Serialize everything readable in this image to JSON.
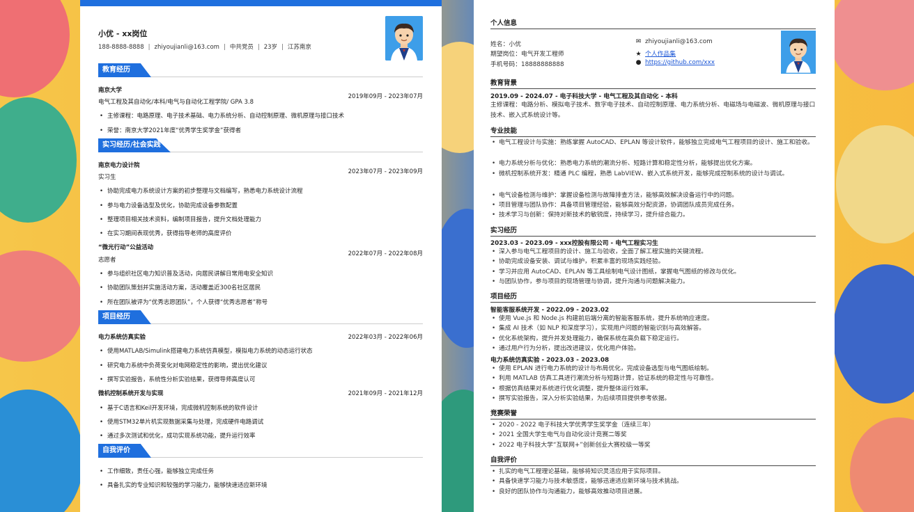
{
  "left": {
    "name": "小优 - xx岗位",
    "contact": [
      "188-8888-8888",
      "zhiyoujianli@163.com",
      "中共党员",
      "23岁",
      "江苏南京"
    ],
    "sections": {
      "education": "教育经历",
      "internship": "实习经历/社会实践",
      "project": "项目经历",
      "self_eval": "自我评价"
    },
    "education": {
      "school": "南京大学",
      "date": "2019年09月 - 2023年07月",
      "major": "电气工程及其自动化/本科/电气与自动化工程学院/ GPA 3.8",
      "bullets": [
        "主修课程：电路原理、电子技术基础、电力系统分析、自动控制原理、微机原理与接口技术",
        "荣誉：南京大学2021年度“优秀学生奖学金”获得者"
      ]
    },
    "internships": [
      {
        "org": "南京电力设计院",
        "date": "2023年07月 - 2023年09月",
        "role": "实习生",
        "bullets": [
          "协助完成电力系统设计方案的初步整理与文档编写，熟悉电力系统设计流程",
          "参与电力设备选型及优化，协助完成设备参数配置",
          "整理项目相关技术资料，编制项目报告，提升文档处理能力",
          "在实习期间表现优秀，获得指导老师的高度评价"
        ]
      },
      {
        "org": "“微光行动”公益活动",
        "date": "2022年07月 - 2022年08月",
        "role": "志愿者",
        "bullets": [
          "参与组织社区电力知识普及活动，向居民讲解日常用电安全知识",
          "协助团队策划并实施活动方案，活动覆盖近300名社区居民",
          "所在团队被评为“优秀志愿团队”，个人获得“优秀志愿者”称号"
        ]
      }
    ],
    "projects": [
      {
        "name": "电力系统仿真实验",
        "date": "2022年03月 - 2022年06月",
        "bullets": [
          "使用MATLAB/Simulink搭建电力系统仿真模型，模拟电力系统的动态运行状态",
          "研究电力系统中负荷变化对电网稳定性的影响，提出优化建议",
          "撰写实验报告，系统性分析实验结果，获得导师高度认可"
        ]
      },
      {
        "name": "微机控制系统开发与实现",
        "date": "2021年09月 - 2021年12月",
        "bullets": [
          "基于C语言和Keil开发环境，完成微机控制系统的软件设计",
          "使用STM32单片机实现数据采集与处理，完成硬件电路调试",
          "通过多次测试和优化，成功实现系统功能，提升运行效率"
        ]
      }
    ],
    "self_eval": [
      "工作细致，责任心强，能够独立完成任务",
      "具备扎实的专业知识和较强的学习能力，能够快速适应新环境"
    ]
  },
  "right": {
    "sections": {
      "personal": "个人信息",
      "education": "教育背景",
      "skills": "专业技能",
      "internship": "实习经历",
      "project": "项目经历",
      "awards": "竞赛荣誉",
      "self_eval": "自我评价"
    },
    "personal": {
      "name": "姓名：小优",
      "position": "期望岗位：电气开发工程师",
      "phone": "手机号码：18888888888",
      "email": "zhiyoujianli@163.com",
      "portfolio": "个人作品集",
      "github": "https://github.com/xxx",
      "icons": [
        "envelope-icon",
        "star-icon",
        "github-icon"
      ]
    },
    "education": {
      "heading": "2019.09 - 2024.07 - 电子科技大学 - 电气工程及其自动化 - 本科",
      "courses": "主修课程：电路分析、模拟电子技术、数字电子技术、自动控制原理、电力系统分析、电磁场与电磁波、微机原理与接口技术、嵌入式系统设计等。"
    },
    "skills": [
      "电气工程设计与实施：熟练掌握 AutoCAD、EPLAN 等设计软件，能够独立完成电气工程项目的设计、施工和验收。",
      "电力系统分析与优化：熟悉电力系统的潮流分析、短路计算和稳定性分析，能够提出优化方案。",
      "微机控制系统开发：精通 PLC 编程，熟悉 LabVIEW、嵌入式系统开发，能够完成控制系统的设计与调试。",
      "电气设备检测与维护：掌握设备检测与故障排查方法，能够高效解决设备运行中的问题。",
      "项目管理与团队协作：具备项目管理经验，能够高效分配资源，协调团队成员完成任务。",
      "技术学习与创新：保持对新技术的敏锐度，持续学习，提升综合能力。"
    ],
    "internship": {
      "heading": "2023.03 - 2023.09 - xxx控股有限公司 - 电气工程实习生",
      "bullets": [
        "深入参与电气工程项目的设计、施工与验收，全面了解工程实施的关键流程。",
        "协助完成设备安装、调试与维护，积累丰富的现场实践经验。",
        "学习并应用 AutoCAD、EPLAN 等工具绘制电气设计图纸，掌握电气图纸的修改与优化。",
        "与团队协作，参与项目的现场管理与协调，提升沟通与问题解决能力。"
      ]
    },
    "projects": [
      {
        "heading": "智能客服系统开发 - 2022.09 - 2023.02",
        "bullets": [
          "使用 Vue.js 和 Node.js 构建前后端分离的智能客服系统，提升系统响应速度。",
          "集成 AI 技术（如 NLP 和深度学习），实现用户问题的智能识别与高效解答。",
          "优化系统架构，提升并发处理能力，确保系统在高负载下稳定运行。",
          "通过用户行为分析，提出改进建议，优化用户体验。"
        ]
      },
      {
        "heading": "电力系统仿真实验 - 2023.03 - 2023.08",
        "bullets": [
          "使用 EPLAN 进行电力系统的设计与布局优化，完成设备选型与电气图纸绘制。",
          "利用 MATLAB 仿真工具进行潮流分析与短路计算，验证系统的稳定性与可靠性。",
          "根据仿真结果对系统进行优化调整，提升整体运行效率。",
          "撰写实验报告，深入分析实验结果，为后续项目提供参考依据。"
        ]
      }
    ],
    "awards": [
      "2020 - 2022 电子科技大学优秀学生奖学金（连续三年）",
      "2021 全国大学生电气与自动化设计竞赛二等奖",
      "2022 电子科技大学“互联网+”创新创业大赛校级一等奖"
    ],
    "self_eval": [
      "扎实的电气工程理论基础，能够将知识灵活应用于实际项目。",
      "具备快速学习能力与技术敏感度，能够迅速适应新环境与技术挑战。",
      "良好的团队协作与沟通能力，能够高效推动项目进展。"
    ]
  }
}
